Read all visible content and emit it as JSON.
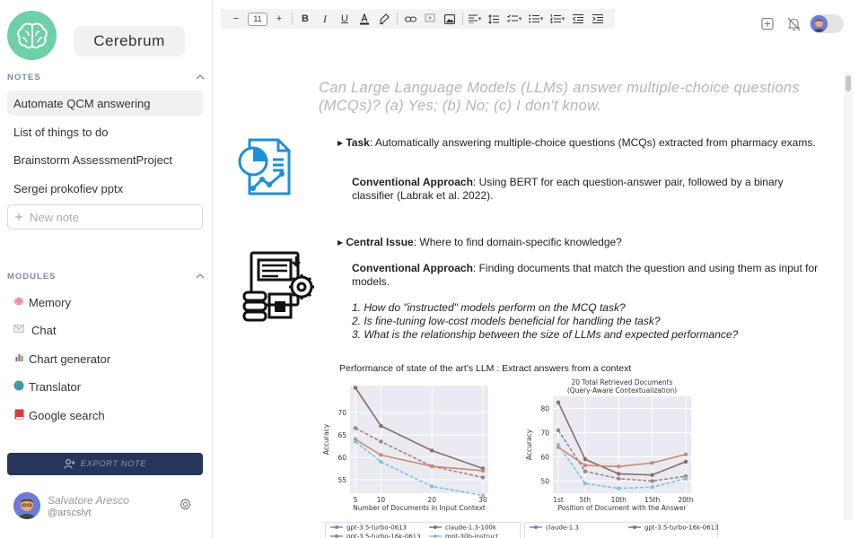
{
  "app": {
    "title": "Cerebrum",
    "logo_icon": "brain-icon",
    "logo_color": "#6fcfa6"
  },
  "sidebar": {
    "notes_header": "NOTES",
    "notes": [
      {
        "label": "Automate QCM answering",
        "active": true
      },
      {
        "label": "List of things to do",
        "active": false
      },
      {
        "label": "Brainstorm AssessmentProject",
        "active": false
      },
      {
        "label": "Sergei prokofiev pptx",
        "active": false
      }
    ],
    "new_note_placeholder": "New note",
    "modules_header": "MODULES",
    "modules": [
      {
        "label": "Memory",
        "icon": "brain-emoji-icon"
      },
      {
        "label": "Chat",
        "icon": "envelope-emoji-icon"
      },
      {
        "label": "Chart generator",
        "icon": "bar-chart-emoji-icon"
      },
      {
        "label": "Translator",
        "icon": "globe-emoji-icon"
      },
      {
        "label": "Google search",
        "icon": "book-emoji-icon"
      }
    ],
    "export_label": "EXPORT NOTE",
    "export_color": "#27355a",
    "user": {
      "name": "Salvatore Aresco",
      "handle": "@arscslvt"
    }
  },
  "toolbar": {
    "font_size": "11"
  },
  "document": {
    "title": "Can Large Language Models (LLMs) answer multiple-choice questions (MCQs)? (a) Yes; (b) No; (c) I don't know.",
    "task_label": "Task",
    "task_text": ": Automatically answering multiple-choice questions (MCQs) extracted from pharmacy exams.",
    "approach1_label": "Conventional Approach",
    "approach1_text": ": Using BERT for each question-answer pair, followed by a binary classifier (Labrak et al. 2022).",
    "issue_label": "Central Issue",
    "issue_text": ": Where to find domain-specific knowledge?",
    "approach2_label": "Conventional Approach",
    "approach2_text": ": Finding documents that match the question and using them as input for models.",
    "questions": [
      "1. How do \"instructed\" models perform on the MCQ task?",
      "2. Is fine-tuning low-cost models beneficial for handling the task?",
      "3. What is the relationship between the size of LLMs and expected performance?"
    ],
    "figure_caption": "Performance of state of the art's LLM : Extract answers from a context"
  },
  "chart_data": [
    {
      "type": "line",
      "title": "",
      "xlabel": "Number of Documents in Input Context",
      "ylabel": "Accuracy",
      "x": [
        5,
        10,
        20,
        30
      ],
      "xticks": [
        "5",
        "10",
        "20",
        "30"
      ],
      "ylim": [
        52,
        76
      ],
      "yticks": [
        55,
        60,
        65,
        70
      ],
      "grid": true,
      "series": [
        {
          "name": "claude-1.3-100k",
          "color": "#8c6d62",
          "dash": false,
          "values": [
            75.5,
            67,
            61.5,
            57.5
          ]
        },
        {
          "name": "gpt-3.5-turbo-16k-0613",
          "color": "#9a8585",
          "dash": true,
          "values": [
            66.5,
            63.5,
            58,
            55.5
          ]
        },
        {
          "name": "gpt-3.5-turbo-0613",
          "color": "#c98a70",
          "dash": false,
          "values": [
            64,
            60.5,
            58,
            57
          ]
        },
        {
          "name": "mpt-30b-instruct",
          "color": "#7fc4d8",
          "dash": true,
          "values": [
            63.5,
            59,
            53.5,
            51.5
          ]
        }
      ]
    },
    {
      "type": "line",
      "title": "20 Total Retrieved Documents\n(Query-Aware Contextualization)",
      "xlabel": "Position of Document with the Answer",
      "ylabel": "Accuracy",
      "x": [
        1,
        5,
        10,
        15,
        20
      ],
      "xticks": [
        "1st",
        "5th",
        "10th",
        "15th",
        "20th"
      ],
      "ylim": [
        45,
        85
      ],
      "yticks": [
        50,
        60,
        70,
        80
      ],
      "grid": true,
      "series": [
        {
          "name": "claude-1.3",
          "color": "#8c6d62",
          "dash": false,
          "values": [
            82.5,
            59,
            53,
            52.5,
            58
          ]
        },
        {
          "name": "gpt-3.5-turbo-16k-0613",
          "color": "#9a8585",
          "dash": true,
          "values": [
            71,
            54,
            51,
            50,
            52
          ]
        },
        {
          "name": "",
          "color": "#c98a70",
          "dash": false,
          "values": [
            64,
            56.5,
            56,
            57.5,
            61
          ]
        },
        {
          "name": "",
          "color": "#7fc4d8",
          "dash": true,
          "values": [
            65,
            49,
            47,
            47.5,
            51
          ]
        }
      ]
    }
  ],
  "legend1": [
    {
      "label": "gpt-3.5-turbo-0613",
      "color": "#7a7fc9"
    },
    {
      "label": "claude-1.3-100k",
      "color": "#8c6d62"
    },
    {
      "label": "gpt-3.5-turbo-16k-0613",
      "color": "#9a8585"
    },
    {
      "label": "mpt-30b-instruct",
      "color": "#7fc4d8"
    }
  ],
  "legend2": [
    {
      "label": "claude-1.3",
      "color": "#7a7fc9"
    },
    {
      "label": "gpt-3.5-turbo-16k-0613",
      "color": "#8c6d62"
    }
  ]
}
